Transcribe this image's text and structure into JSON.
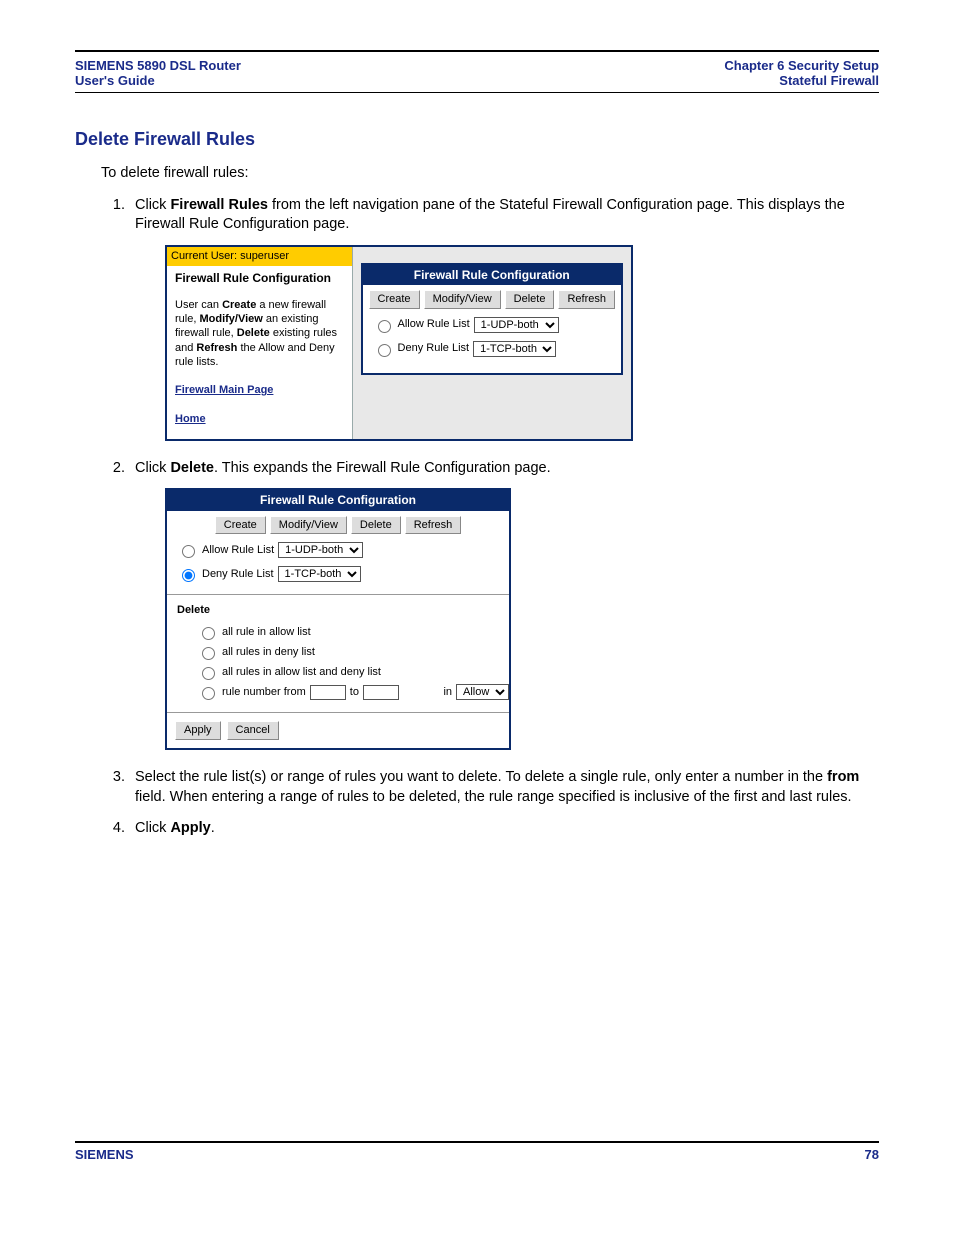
{
  "header": {
    "left_line1": "SIEMENS 5890 DSL Router",
    "left_line2": "User's Guide",
    "right_line1": "Chapter 6  Security Setup",
    "right_line2": "Stateful Firewall"
  },
  "section_title": "Delete Firewall Rules",
  "intro": "To delete firewall rules:",
  "steps": {
    "s1_pre": "Click ",
    "s1_bold": "Firewall Rules",
    "s1_post": " from the left navigation pane of the Stateful Firewall Configuration page. This displays the Firewall Rule Configuration page.",
    "s2_pre": "Click ",
    "s2_bold": "Delete",
    "s2_post": ". This expands the Firewall Rule Configuration page.",
    "s3_pre": "Select the rule list(s) or range of rules you want to delete. To delete a single rule, only enter a number in the ",
    "s3_bold": "from",
    "s3_post": " field. When entering a range of rules to be deleted, the rule range specified is inclusive of the first and last rules.",
    "s4_pre": "Click ",
    "s4_bold": "Apply",
    "s4_post": "."
  },
  "shot1": {
    "user_label": "Current User: superuser",
    "panel_title": "Firewall Rule Configuration",
    "help_p1a": "User can ",
    "help_p1b": "Create",
    "help_p1c": " a new firewall rule, ",
    "help_p1d": "Modify/View",
    "help_p1e": " an existing firewall rule, ",
    "help_p1f": "Delete",
    "help_p1g": " existing rules and ",
    "help_p1h": "Refresh",
    "help_p1i": " the Allow and Deny rule lists.",
    "link_main": "Firewall Main Page",
    "link_home": "Home",
    "config_title": "Firewall Rule Configuration",
    "btn_create": "Create",
    "btn_modify": "Modify/View",
    "btn_delete": "Delete",
    "btn_refresh": "Refresh",
    "allow_label": "Allow Rule List",
    "allow_value": "1-UDP-both",
    "deny_label": "Deny Rule List",
    "deny_value": "1-TCP-both"
  },
  "shot2": {
    "config_title": "Firewall Rule Configuration",
    "btn_create": "Create",
    "btn_modify": "Modify/View",
    "btn_delete": "Delete",
    "btn_refresh": "Refresh",
    "allow_label": "Allow Rule List",
    "allow_value": "1-UDP-both",
    "deny_label": "Deny Rule List",
    "deny_value": "1-TCP-both",
    "delete_section": "Delete",
    "opt_allow": "all rule in allow list",
    "opt_deny": "all rules in deny list",
    "opt_both": "all rules in allow list and deny list",
    "opt_range_pre": "rule number from",
    "opt_range_mid": "to",
    "opt_range_in": "in",
    "opt_range_sel": "Allow",
    "btn_apply": "Apply",
    "btn_cancel": "Cancel"
  },
  "footer": {
    "brand": "SIEMENS",
    "page": "78"
  }
}
